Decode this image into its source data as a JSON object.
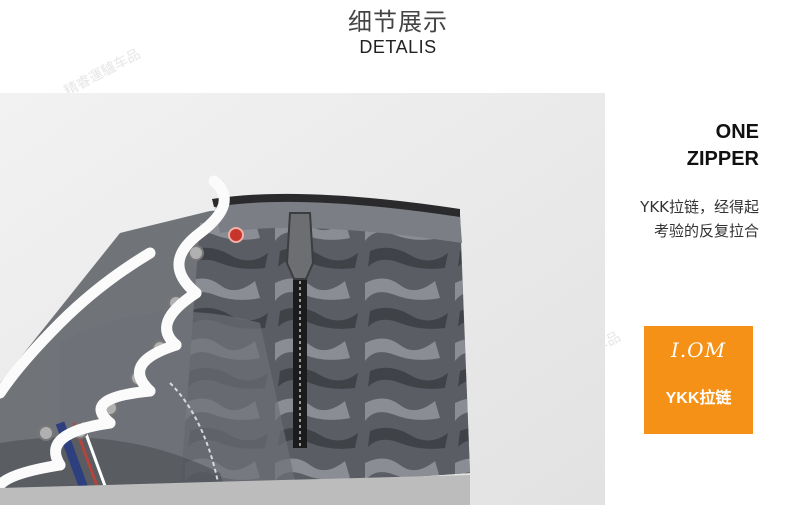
{
  "header": {
    "title_cn": "细节展示",
    "title_en": "DETALIS"
  },
  "photo": {
    "subject": "shoe-zipper-closeup"
  },
  "feature": {
    "title_line1": "ONE",
    "title_line2": "ZIPPER",
    "desc_line1": "YKK拉链，经得起",
    "desc_line2": "考验的反复拉合"
  },
  "badge": {
    "icon_text": "I.OM",
    "label": "YKK拉链",
    "color": "#f49116"
  },
  "watermark": {
    "text": "精睿運驢车品"
  }
}
